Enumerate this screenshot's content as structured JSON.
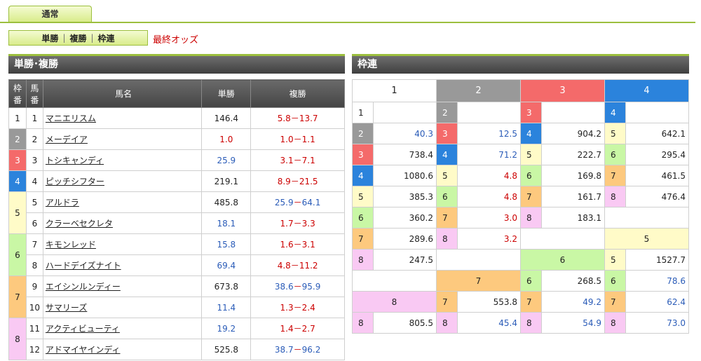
{
  "tabs": {
    "active": "通常"
  },
  "subnav": {
    "items": [
      "単勝",
      "複勝",
      "枠連"
    ],
    "latest_label": "最終オッズ"
  },
  "sections": {
    "win_place": "単勝･複勝",
    "wakuren": "枠連"
  },
  "win_table": {
    "headers": {
      "frame": "枠番",
      "num": "馬番",
      "name": "馬名",
      "win": "単勝",
      "place": "複勝"
    },
    "frames": [
      "1",
      "2",
      "3",
      "4",
      "5",
      "6",
      "7",
      "8"
    ],
    "rows": [
      {
        "num": "1",
        "name": "マニエリスム",
        "win": "146.4",
        "place_lo": "5.8",
        "place_hi": "13.7"
      },
      {
        "num": "2",
        "name": "メーデイア",
        "win": "1.0",
        "place_lo": "1.0",
        "place_hi": "1.1"
      },
      {
        "num": "3",
        "name": "トシキャンディ",
        "win": "25.9",
        "place_lo": "3.1",
        "place_hi": "7.1"
      },
      {
        "num": "4",
        "name": "ピッチシフター",
        "win": "219.1",
        "place_lo": "8.9",
        "place_hi": "21.5"
      },
      {
        "num": "5",
        "name": "アルドラ",
        "win": "485.8",
        "place_lo": "25.9",
        "place_hi": "64.1"
      },
      {
        "num": "6",
        "name": "クラーベセクレタ",
        "win": "18.1",
        "place_lo": "1.7",
        "place_hi": "3.3"
      },
      {
        "num": "7",
        "name": "キモンレッド",
        "win": "15.8",
        "place_lo": "1.6",
        "place_hi": "3.1"
      },
      {
        "num": "8",
        "name": "ハードデイズナイト",
        "win": "69.4",
        "place_lo": "4.8",
        "place_hi": "11.2"
      },
      {
        "num": "9",
        "name": "エイシンルンディー",
        "win": "673.8",
        "place_lo": "38.6",
        "place_hi": "95.9"
      },
      {
        "num": "10",
        "name": "サマリーズ",
        "win": "11.4",
        "place_lo": "1.3",
        "place_hi": "2.4"
      },
      {
        "num": "11",
        "name": "アクティビューティ",
        "win": "19.2",
        "place_lo": "1.4",
        "place_hi": "2.7"
      },
      {
        "num": "12",
        "name": "アドマイヤインディ",
        "win": "525.8",
        "place_lo": "38.7",
        "place_hi": "96.2"
      }
    ],
    "place_separator": "－"
  },
  "wakuren": {
    "headers": [
      "1",
      "2",
      "3",
      "4",
      "5",
      "6",
      "7",
      "8"
    ],
    "g1": {
      "1-1": "",
      "1-2": "40.3",
      "1-3": "738.4",
      "1-4": "1080.6",
      "1-5": "385.3",
      "1-6": "360.2",
      "1-7": "289.6",
      "1-8": "247.5"
    },
    "g2": {
      "2-2": "",
      "2-3": "12.5",
      "2-4": "71.2",
      "2-5": "4.8",
      "2-6": "4.8",
      "2-7": "3.0",
      "2-8": "3.2"
    },
    "g3": {
      "3-3": "",
      "3-4": "904.2",
      "3-5": "222.7",
      "3-6": "169.8",
      "3-7": "161.7",
      "3-8": "183.1"
    },
    "g4": {
      "4-4": "",
      "4-5": "642.1",
      "4-6": "295.4",
      "4-7": "461.5",
      "4-8": "476.4"
    },
    "g5": {
      "5-5": "",
      "5-6": "1527.7",
      "5-7": "",
      "5-8": ""
    },
    "g6": {
      "6-6": "268.5",
      "6-7": "78.6",
      "6-8": ""
    },
    "g7": {
      "7-7": "553.8",
      "7-8": "49.2",
      "7-8b": "62.4"
    },
    "g8": {
      "8-8": "805.5",
      "8-8b": "45.4",
      "8-8c": "54.9",
      "8-8d": "73.0"
    }
  },
  "colors": {
    "accent": "#9cbf3e",
    "red": "#cc0000",
    "blue": "#2b5cb8"
  }
}
